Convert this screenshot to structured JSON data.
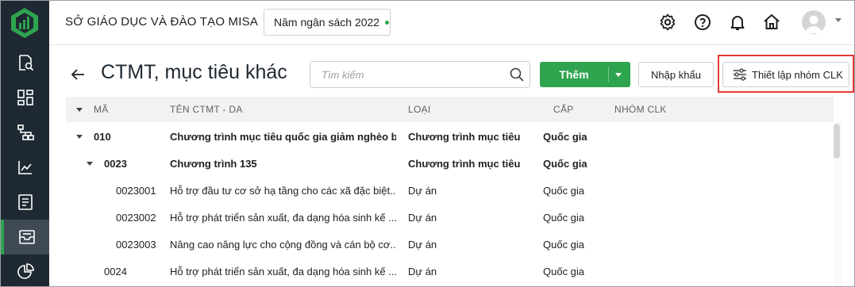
{
  "header": {
    "org_title": "SỞ GIÁO DỤC VÀ ĐÀO TẠO MISA",
    "budget_year": "Năm ngân sách 2022"
  },
  "sidebar": {
    "items": [
      {
        "icon": "report-search-icon"
      },
      {
        "icon": "dashboard-icon"
      },
      {
        "icon": "hierarchy-icon"
      },
      {
        "icon": "line-chart-icon"
      },
      {
        "icon": "checklist-icon"
      },
      {
        "icon": "inbox-icon",
        "active": true
      },
      {
        "icon": "pie-chart-icon"
      }
    ]
  },
  "page": {
    "title": "CTMT, mục tiêu khác",
    "search_placeholder": "Tìm kiếm",
    "add_label": "Thêm",
    "import_label": "Nhập khẩu",
    "group_setup_label": "Thiết lập nhóm CLK"
  },
  "table": {
    "columns": [
      "MÃ",
      "TÊN CTMT - DA",
      "LOẠI",
      "CẤP",
      "NHÓM CLK"
    ],
    "rows": [
      {
        "code": "010",
        "name": "Chương trình mục tiêu quốc gia giảm nghèo bề...",
        "type": "Chương trình mục tiêu",
        "level": "Quốc gia",
        "group": "",
        "bold": true,
        "expandable": true,
        "depth": 0
      },
      {
        "code": "0023",
        "name": "Chương trình 135",
        "type": "Chương trình mục tiêu",
        "level": "Quốc gia",
        "group": "",
        "bold": true,
        "expandable": true,
        "depth": 1
      },
      {
        "code": "0023001",
        "name": "Hỗ trợ đầu tư cơ sở hạ tầng cho các xã đặc biệt...",
        "type": "Dự án",
        "level": "Quốc gia",
        "group": "",
        "bold": false,
        "expandable": false,
        "depth": 2
      },
      {
        "code": "0023002",
        "name": "Hỗ trợ phát triển sản xuất, đa dạng hóa sinh kế ...",
        "type": "Dự án",
        "level": "Quốc gia",
        "group": "",
        "bold": false,
        "expandable": false,
        "depth": 2
      },
      {
        "code": "0023003",
        "name": "Nâng cao năng lực cho cộng đồng và cán bộ cơ...",
        "type": "Dự án",
        "level": "Quốc gia",
        "group": "",
        "bold": false,
        "expandable": false,
        "depth": 2
      },
      {
        "code": "0024",
        "name": "Hỗ trợ phát triển sản xuất, đa dạng hóa sinh kế ...",
        "type": "Dự án",
        "level": "Quốc gia",
        "group": "",
        "bold": false,
        "expandable": false,
        "depth": 1
      }
    ]
  },
  "colors": {
    "sidebar_bg": "#1f2933",
    "accent_green": "#2ea44f",
    "highlight_red": "#e53935"
  }
}
